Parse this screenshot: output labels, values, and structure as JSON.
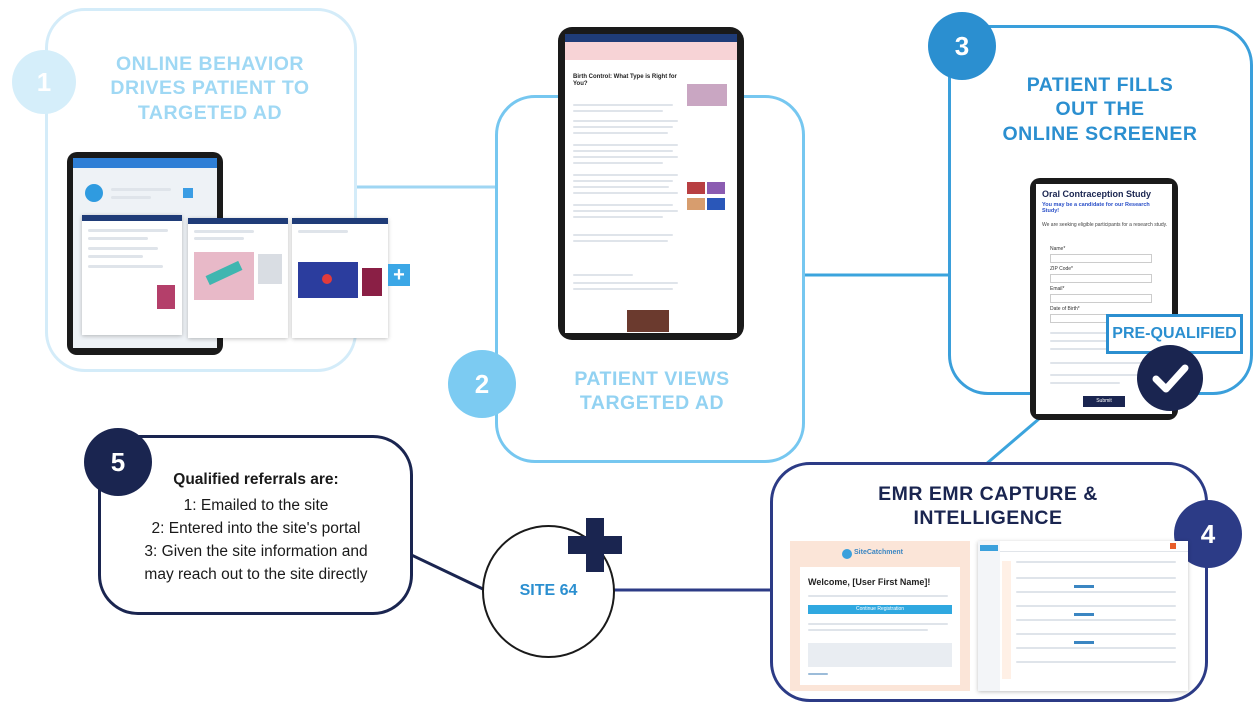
{
  "step1": {
    "number": "1",
    "title_lines": [
      "ONLINE BEHAVIOR",
      "DRIVES PATIENT TO",
      "TARGETED AD"
    ],
    "plus": "+"
  },
  "step2": {
    "number": "2",
    "title_lines": [
      "PATIENT VIEWS",
      "TARGETED AD"
    ],
    "article_title": "Birth Control: What Type is Right for You?"
  },
  "step3": {
    "number": "3",
    "title_lines": [
      "PATIENT FILLS",
      "OUT THE",
      "ONLINE SCREENER"
    ],
    "form_title": "Oral Contraception Study",
    "form_subtitle": "You may be a candidate for our Research Study!",
    "form_intro": "We are seeking eligible participants for a research study.",
    "form_fields": [
      "Name*",
      "ZIP Code*",
      "Email*",
      "Date of Birth*"
    ],
    "form_button": "Submit",
    "badge": "PRE-QUALIFIED"
  },
  "step4": {
    "number": "4",
    "title_lines": [
      "EMR EMR CAPTURE &",
      "INTELLIGENCE"
    ],
    "logo_text": "SiteCatchment",
    "welcome": "Welcome, [User First Name]!",
    "welcome_button": "Continue Registration"
  },
  "step5": {
    "number": "5",
    "heading": "Qualified referrals are:",
    "items": [
      "1: Emailed to the site",
      "2: Entered into the site's portal",
      "3: Given the site information and",
      "may reach out to the site directly"
    ]
  },
  "site": {
    "label": "SITE 64"
  },
  "colors": {
    "light_blue": "#74c6ee",
    "medium_blue": "#2b8fd0",
    "dark_blue": "#27378a",
    "navy": "#1a2550",
    "pale_circle": "#d5eefa"
  }
}
